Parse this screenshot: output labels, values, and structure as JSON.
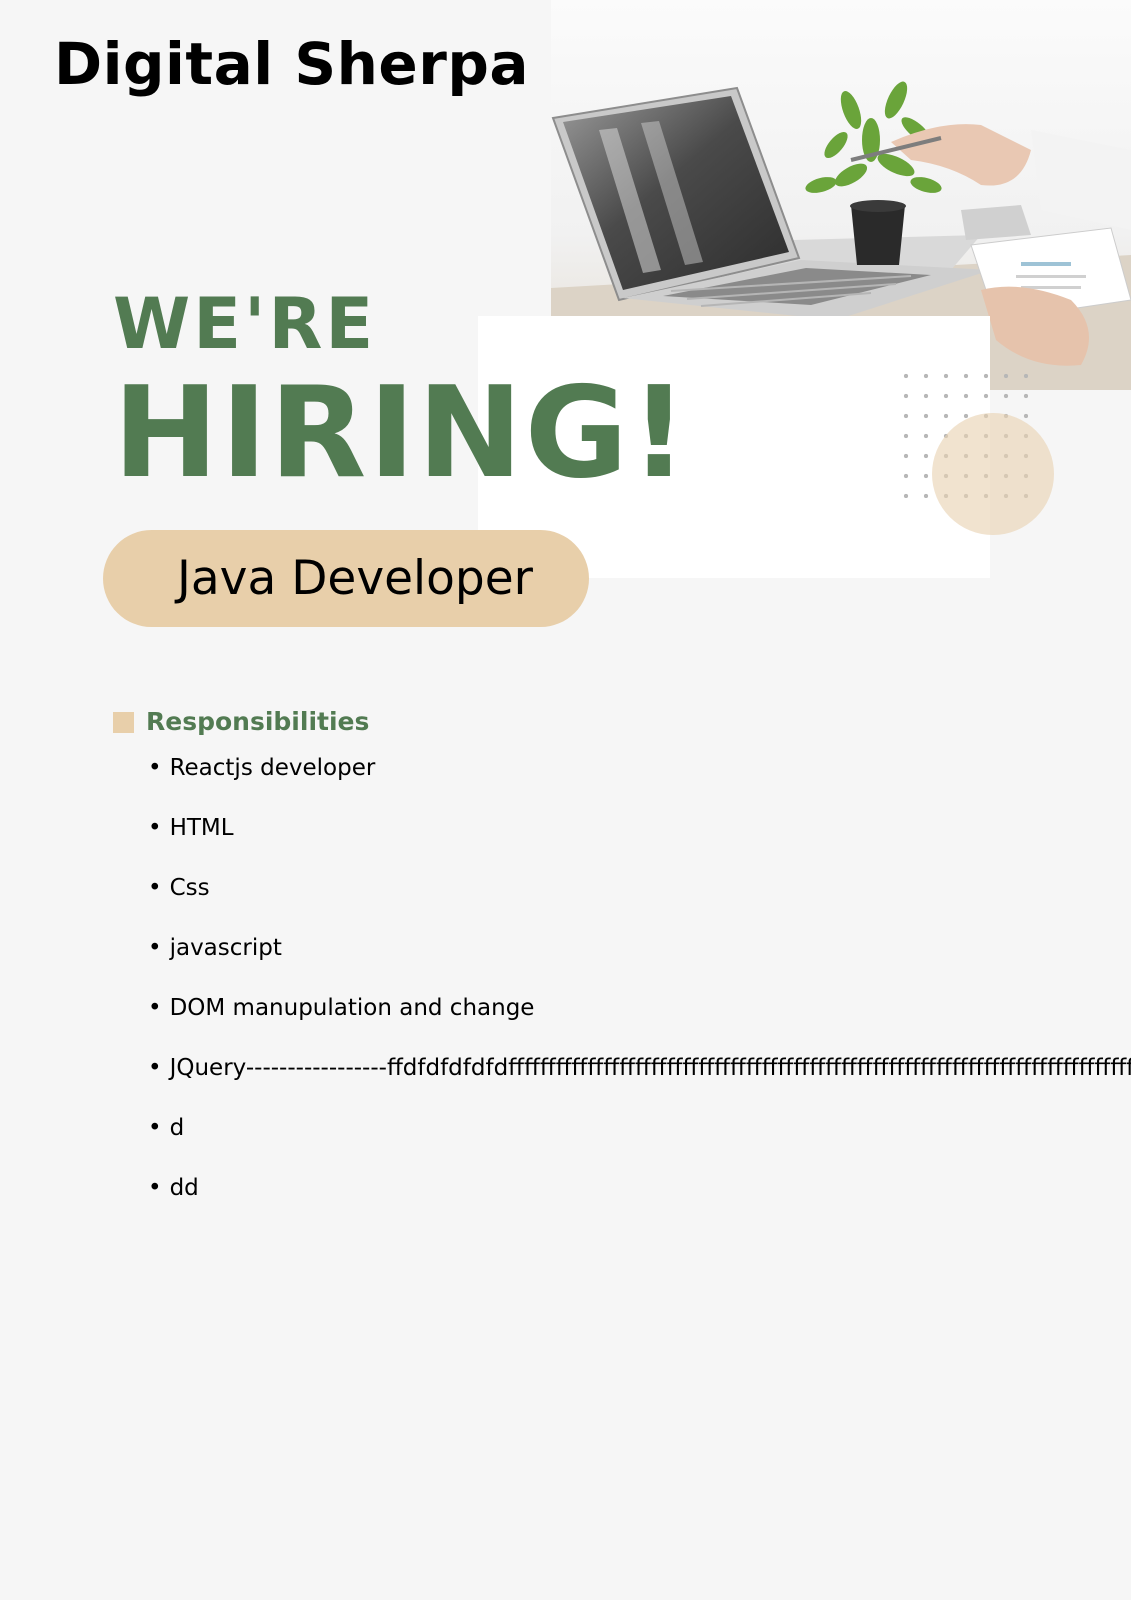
{
  "header": {
    "company": "Digital Sherpa"
  },
  "hero": {
    "line1": "WE'RE",
    "line2": "HIRING!",
    "role": "Java Developer",
    "photo_subject": "laptop-on-desk-with-plant"
  },
  "responsibilities": {
    "title": "Responsibilities",
    "items": [
      "Reactjs developer",
      "HTML",
      "Css",
      "javascript",
      "DOM manupulation and change",
      "JQuery-----------------ffdfdfdfdfdffffffffffffffffffffffffffffffffffffffffffffffffffffffffffffffffffffffffffffffffffffffffffffffffffffffffffffffffffffff",
      "d",
      "dd"
    ]
  },
  "colors": {
    "accent_green": "#527b52",
    "accent_beige": "#e8cfaa",
    "background": "#f6f6f6"
  }
}
